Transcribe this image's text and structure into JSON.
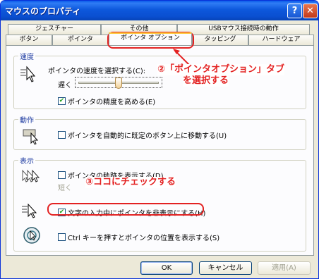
{
  "window": {
    "title": "マウスのプロパティ",
    "help_label": "?",
    "close_label": "✕"
  },
  "tabs_top": [
    {
      "label": "ジェスチャー"
    },
    {
      "label": "その他"
    },
    {
      "label": "USBマウス接続時の動作"
    }
  ],
  "tabs_bottom": [
    {
      "label": "ボタン"
    },
    {
      "label": "ポインタ"
    },
    {
      "label": "ポインタ オプション",
      "active": true
    },
    {
      "label": "タッピング"
    },
    {
      "label": "ハードウェア"
    }
  ],
  "speed": {
    "group_label": "速度",
    "select_label": "ポインタの速度を選択する(C):",
    "slow_label": "遅く",
    "slider_level": 0.5,
    "precision_label": "ポインタの精度を高める(E)",
    "precision_checked": true
  },
  "motion": {
    "group_label": "動作",
    "snap_label": "ポインタを自動的に既定のボタン上に移動する(U)",
    "snap_checked": false
  },
  "display": {
    "group_label": "表示",
    "trails_label": "ポインタの軌跡を表示する(D)",
    "trails_checked": false,
    "short_label": "短く",
    "hide_label": "文字の入力中にポインタを非表示にする(H)",
    "hide_checked": true,
    "ctrl_label": "Ctrl キーを押すとポインタの位置を表示する(S)",
    "ctrl_checked": false
  },
  "buttons": {
    "ok": "OK",
    "cancel": "キャンセル",
    "apply": "適用(A)"
  },
  "annotations": {
    "tab_note_line1": "②「ポインタオプション」タブ",
    "tab_note_line2": "を選択する",
    "check_note": "③ココにチェックする"
  },
  "colors": {
    "annotation": "#e32222",
    "titlebar": "#0a4fd0",
    "check": "#21a121"
  }
}
